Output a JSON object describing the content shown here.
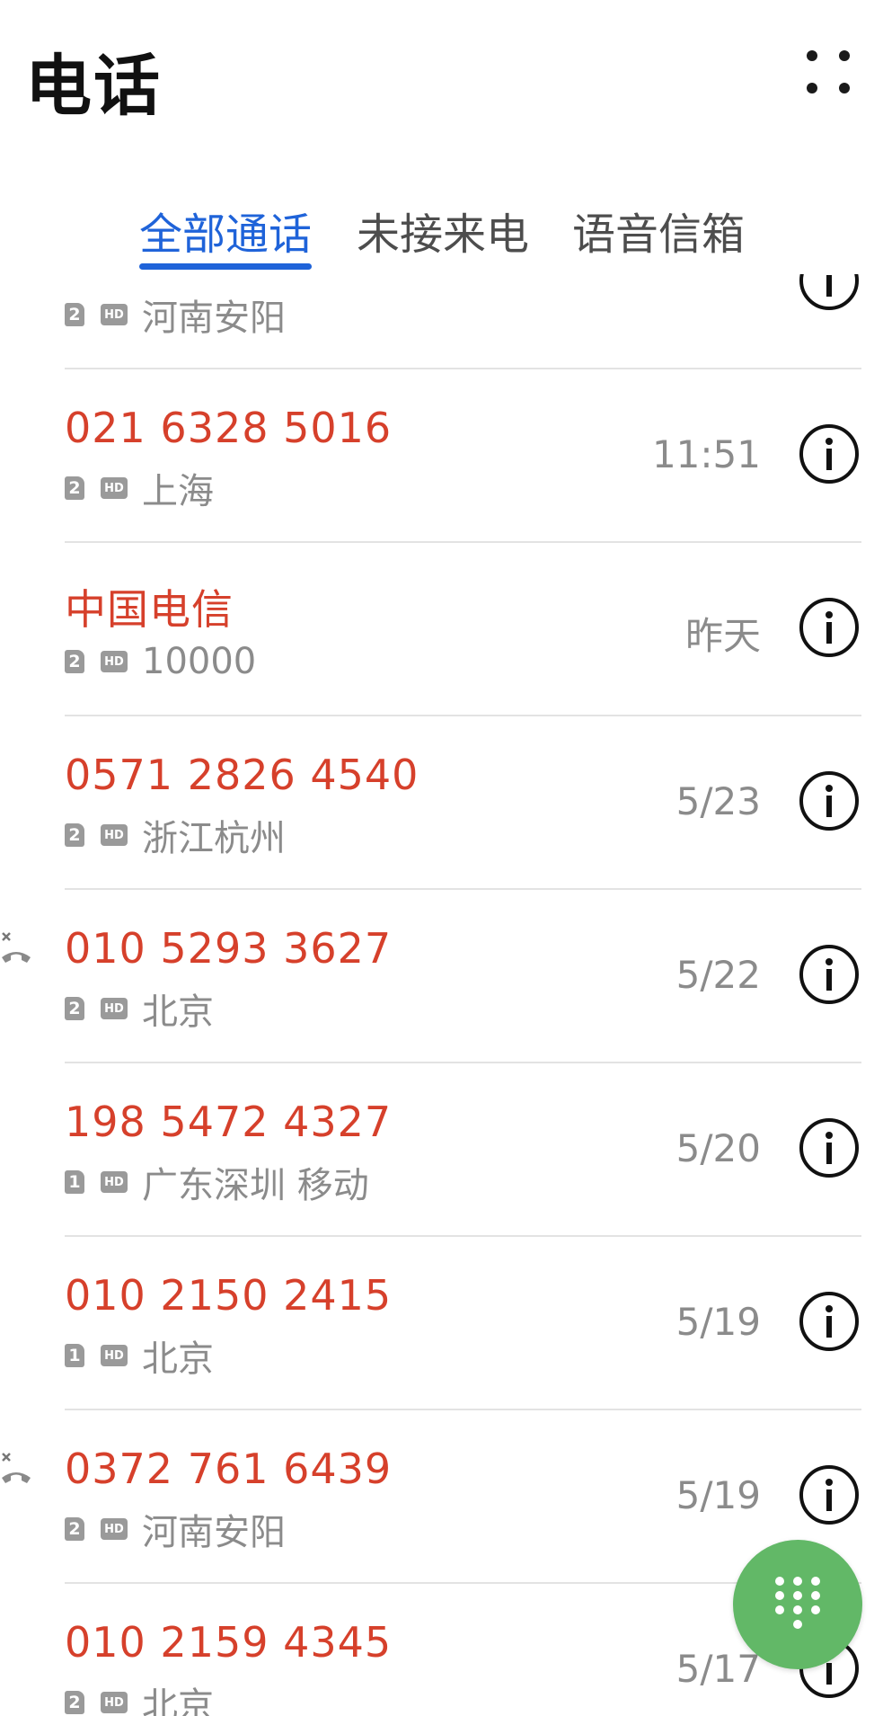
{
  "header": {
    "title": "电话"
  },
  "tabs": [
    {
      "label": "全部通话",
      "active": true
    },
    {
      "label": "未接来电",
      "active": false
    },
    {
      "label": "语音信箱",
      "active": false
    }
  ],
  "calls": [
    {
      "number": "",
      "sim": "2",
      "hd": "HD",
      "location": "河南安阳",
      "time": "",
      "missed_icon": false
    },
    {
      "number": "021 6328 5016",
      "sim": "2",
      "hd": "HD",
      "location": "上海",
      "time": "11:51",
      "missed_icon": false
    },
    {
      "number": "中国电信",
      "sim": "2",
      "hd": "HD",
      "location": "10000",
      "time": "昨天",
      "missed_icon": false
    },
    {
      "number": "0571 2826 4540",
      "sim": "2",
      "hd": "HD",
      "location": "浙江杭州",
      "time": "5/23",
      "missed_icon": false
    },
    {
      "number": "010 5293 3627",
      "sim": "2",
      "hd": "HD",
      "location": "北京",
      "time": "5/22",
      "missed_icon": true
    },
    {
      "number": "198 5472 4327",
      "sim": "1",
      "hd": "HD",
      "location": "广东深圳 移动",
      "time": "5/20",
      "missed_icon": false
    },
    {
      "number": "010 2150 2415",
      "sim": "1",
      "hd": "HD",
      "location": "北京",
      "time": "5/19",
      "missed_icon": false
    },
    {
      "number": "0372 761 6439",
      "sim": "2",
      "hd": "HD",
      "location": "河南安阳",
      "time": "5/19",
      "missed_icon": true
    },
    {
      "number": "010 2159 4345",
      "sim": "2",
      "hd": "HD",
      "location": "北京",
      "time": "5/17",
      "missed_icon": false
    }
  ],
  "icons": {
    "more": "more-dots-icon",
    "info": "info-circle-icon",
    "missed": "missed-call-icon",
    "dialpad": "dialpad-icon"
  },
  "colors": {
    "accent": "#1f63d9",
    "missed_number": "#d6402b",
    "secondary_text": "#8b8b8b",
    "fab": "#62b867"
  }
}
